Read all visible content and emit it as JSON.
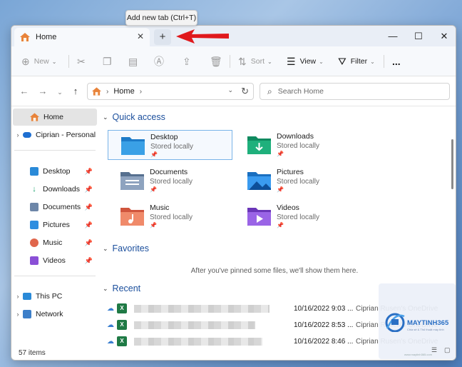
{
  "tooltip": "Add new tab (Ctrl+T)",
  "tab": {
    "label": "Home"
  },
  "toolbar": {
    "new": "New",
    "sort": "Sort",
    "view": "View",
    "filter": "Filter",
    "more": "..."
  },
  "address": {
    "segment": "Home"
  },
  "search": {
    "placeholder": "Search Home"
  },
  "sidebar": {
    "home": "Home",
    "onedrive": "Ciprian - Personal",
    "pinned": [
      "Desktop",
      "Downloads",
      "Documents",
      "Pictures",
      "Music",
      "Videos"
    ],
    "thispc": "This PC",
    "network": "Network"
  },
  "quick_access": {
    "title": "Quick access",
    "items": [
      {
        "name": "Desktop",
        "sub": "Stored locally"
      },
      {
        "name": "Downloads",
        "sub": "Stored locally"
      },
      {
        "name": "Documents",
        "sub": "Stored locally"
      },
      {
        "name": "Pictures",
        "sub": "Stored locally"
      },
      {
        "name": "Music",
        "sub": "Stored locally"
      },
      {
        "name": "Videos",
        "sub": "Stored locally"
      }
    ]
  },
  "favorites": {
    "title": "Favorites",
    "empty": "After you've pinned some files, we'll show them here."
  },
  "recent": {
    "title": "Recent",
    "rows": [
      {
        "date": "10/16/2022 9:03 ...",
        "location": "Ciprian Rusen's OneDrive"
      },
      {
        "date": "10/16/2022 8:53 ...",
        "location": "Ciprian Rusen's OneDrive"
      },
      {
        "date": "10/16/2022 8:46 ...",
        "location": "Ciprian Rusen's OneDrive"
      }
    ]
  },
  "status": {
    "count": "57 items"
  },
  "watermark": {
    "brand": "MAYTINH365",
    "sub": "Chia sẻ & Thủ thuật máy tính",
    "foot": "www.maytinh365.com"
  }
}
